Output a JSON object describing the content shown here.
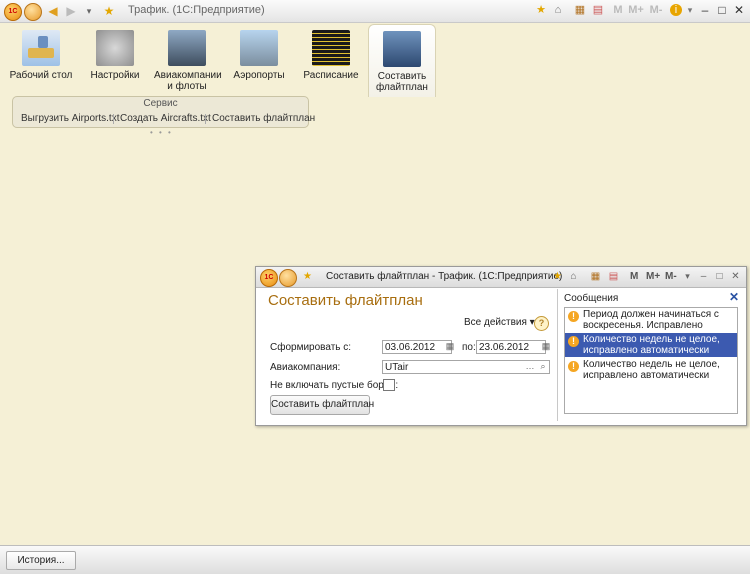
{
  "window": {
    "title": "Трафик. (1С:Предприятие)"
  },
  "toolbar": {
    "m_labels": [
      "M",
      "M+",
      "M-"
    ]
  },
  "sections": [
    {
      "label": "Рабочий стол",
      "icon": "desktop-icon"
    },
    {
      "label": "Настройки",
      "icon": "tools-icon"
    },
    {
      "label": "Авиакомпании и флоты",
      "icon": "aircraft-photo-icon"
    },
    {
      "label": "Аэропорты",
      "icon": "airport-photo-icon"
    },
    {
      "label": "Расписание",
      "icon": "schedule-board-icon"
    },
    {
      "label": "Составить флайтплан",
      "icon": "flightplan-photo-icon"
    }
  ],
  "service": {
    "title": "Сервис",
    "links": [
      "Выгрузить Airports.txt",
      "Создать Aircrafts.txt",
      "Составить флайтплан"
    ]
  },
  "modal": {
    "title": "Составить флайтплан - Трафик. (1С:Предприятие)",
    "m_labels": [
      "M",
      "M+",
      "M-"
    ],
    "heading": "Составить флайтплан",
    "all_actions": "Все действия ▾",
    "form_from_label": "Сформировать с:",
    "date_from": "03.06.2012",
    "to_label": "по:",
    "date_to": "23.06.2012",
    "airline_label": "Авиакомпания:",
    "airline_value": "UTair",
    "skip_empty_label": "Не включать пустые борты:",
    "skip_empty_checked": false,
    "submit_label": "Составить флайтплан"
  },
  "messages": {
    "title": "Сообщения",
    "items": [
      {
        "text": "Период должен начинаться с воскресенья. Исправлено",
        "selected": false
      },
      {
        "text": "Количество недель не целое, исправлено автоматически",
        "selected": true
      },
      {
        "text": "Количество недель не целое, исправлено автоматически",
        "selected": false
      }
    ]
  },
  "statusbar": {
    "history_label": "История..."
  }
}
